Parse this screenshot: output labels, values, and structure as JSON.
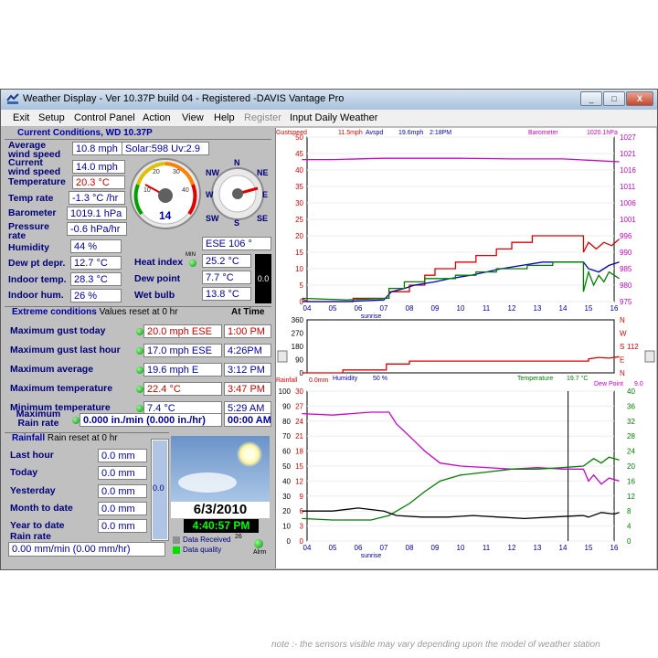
{
  "window": {
    "title": "Weather Display - Ver 10.37P build 04 - Registered  -DAVIS Vantage Pro",
    "buttons": {
      "minimize": "_",
      "maximize": "□",
      "close": "X"
    }
  },
  "menu": [
    "Exit",
    "Setup",
    "Control Panel",
    "Action",
    "View",
    "Help",
    "Register",
    "Input Daily Weather"
  ],
  "current": {
    "heading": "Current Conditions, WD 10.37P",
    "avg_wind_label": "Average wind speed",
    "avg_wind": "10.8 mph",
    "solar": "Solar:598 Uv:2.9",
    "cur_wind_label": "Current wind speed",
    "cur_wind": "14.0 mph",
    "temp_label": "Temperature",
    "temp": "20.3 °C",
    "temp_rate_label": "Temp rate",
    "temp_rate": "-1.3 °C /hr",
    "baro_label": "Barometer",
    "baro": "1019.1 hPa",
    "press_rate_label": "Pressure rate",
    "press_rate": "-0.6 hPa/hr",
    "humidity_label": "Humidity",
    "humidity": "44 %",
    "dew_label": "Dew pt depr.",
    "dew": "12.7 °C",
    "indoor_temp_label": "Indoor temp.",
    "indoor_temp": "28.3 °C",
    "indoor_hum_label": "Indoor hum.",
    "indoor_hum": "26 %",
    "heat_label": "Heat index",
    "heat": "25.2 °C",
    "min_label": "MIN",
    "dewpoint_label": "Dew point",
    "dewpoint": "7.7 °C",
    "wetbulb_label": "Wet bulb",
    "wetbulb": "13.8 °C",
    "wind_dir": "ESE  106 °",
    "gauge_value": "14",
    "gauge_ticks": [
      "10",
      "20",
      "30",
      "40"
    ],
    "compass": {
      "n": "N",
      "ne": "NE",
      "e": "E",
      "se": "SE",
      "s": "S",
      "sw": "SW",
      "w": "W",
      "nw": "NW"
    },
    "black_box": "0.0"
  },
  "extreme": {
    "heading": "Extreme conditions",
    "sub": "Values reset at 0 hr",
    "at_time": "At Time",
    "rows": [
      {
        "label": "Maximum gust today",
        "value": "20.0 mph ESE",
        "time": "1:00 PM",
        "red": true
      },
      {
        "label": "Maximum gust last hour",
        "value": "17.0 mph ESE",
        "time": "4:26PM",
        "red": false
      },
      {
        "label": "Maximum average",
        "value": "19.6 mph E",
        "time": "3:12 PM",
        "red": false
      },
      {
        "label": "Maximum temperature",
        "value": "22.4 °C",
        "time": "3:47 PM",
        "red": true
      },
      {
        "label": "Minimum temperature",
        "value": "7.4 °C",
        "time": "5:29 AM",
        "red": false
      }
    ],
    "rain_rate_label": "Maximum Rain rate",
    "rain_rate": "0.000 in./min (0.000 in./hr)",
    "rain_rate_time": "00:00 AM"
  },
  "rainfall": {
    "heading": "Rainfall",
    "sub": "Rain reset at 0 hr",
    "rows": [
      {
        "label": "Last hour",
        "value": "0.0 mm"
      },
      {
        "label": "Today",
        "value": "0.0 mm"
      },
      {
        "label": "Yesterday",
        "value": "0.0 mm"
      },
      {
        "label": "Month to date",
        "value": "0.0 mm"
      },
      {
        "label": "Year to date",
        "value": "0.0 mm"
      }
    ],
    "gauge": "0.0",
    "rate_label": "Rain rate",
    "rate": "0.00 mm/min (0.00 mm/hr)"
  },
  "status": {
    "date": "6/3/2010",
    "clock": "4:40:57 PM",
    "data_received": "Data Received",
    "data_received_count": "26",
    "data_quality": "Data quality",
    "alarm": "Alrm"
  },
  "colors": {
    "gust": "#e00000",
    "avg": "#0000c0",
    "baro": "#d000d0",
    "temp": "#008000",
    "humidity": "#d000d0"
  },
  "chart_data": [
    {
      "type": "line",
      "header": {
        "gust_label": "Gustspeed",
        "gust_val": "11.5mph",
        "avg_label": "Avspd",
        "avg_val": "19.6mph",
        "time": "2:18PM",
        "baro_label": "Barometer",
        "baro_val": "1020.1hPa"
      },
      "x_ticks": [
        "04",
        "05",
        "06",
        "07",
        "08",
        "09",
        "10",
        "11",
        "12",
        "13",
        "14",
        "15",
        "16"
      ],
      "xlabel": "sunrise",
      "y_left_ticks": [
        "50",
        "45",
        "40",
        "35",
        "30",
        "25",
        "20",
        "15",
        "10",
        "5",
        "0"
      ],
      "y_right_ticks": [
        "1027",
        "1021",
        "1016",
        "1011",
        "1006",
        "1001",
        "996",
        "990",
        "985",
        "980",
        "975"
      ],
      "ylim": [
        0,
        50
      ],
      "y2lim": [
        975,
        1027
      ],
      "series": [
        {
          "key": "baro",
          "axis": "right",
          "points": [
            [
              3.8,
              1019.9
            ],
            [
              5,
              1019.9
            ],
            [
              7,
              1020.3
            ],
            [
              10,
              1020.3
            ],
            [
              12,
              1020.1
            ],
            [
              14,
              1020.1
            ],
            [
              15,
              1019.7
            ],
            [
              16.2,
              1019.2
            ]
          ]
        },
        {
          "key": "gust",
          "axis": "left",
          "points": [
            [
              3.8,
              1
            ],
            [
              4,
              0
            ],
            [
              5.8,
              0
            ],
            [
              5.8,
              1
            ],
            [
              7.2,
              1
            ],
            [
              7.2,
              3
            ],
            [
              8,
              3
            ],
            [
              8,
              5
            ],
            [
              8.6,
              5
            ],
            [
              8.6,
              8
            ],
            [
              9,
              8
            ],
            [
              9,
              10
            ],
            [
              9.8,
              10
            ],
            [
              9.8,
              12
            ],
            [
              10.6,
              12
            ],
            [
              10.6,
              14
            ],
            [
              11.4,
              14
            ],
            [
              11.4,
              16
            ],
            [
              12,
              16
            ],
            [
              12,
              18
            ],
            [
              12.8,
              18
            ],
            [
              12.8,
              20
            ],
            [
              14.8,
              20
            ],
            [
              14.8,
              15
            ],
            [
              15,
              18
            ],
            [
              15.3,
              16
            ],
            [
              15.6,
              18
            ],
            [
              15.9,
              17
            ],
            [
              16.2,
              19
            ]
          ]
        },
        {
          "key": "avg",
          "axis": "left",
          "points": [
            [
              3.8,
              0
            ],
            [
              5.5,
              0
            ],
            [
              7,
              0.5
            ],
            [
              7.3,
              3
            ],
            [
              7.8,
              4
            ],
            [
              8.2,
              5
            ],
            [
              9,
              6
            ],
            [
              9.6,
              7
            ],
            [
              10.4,
              8
            ],
            [
              11,
              9
            ],
            [
              11.6,
              10
            ],
            [
              12.4,
              11
            ],
            [
              13.2,
              12
            ],
            [
              14.8,
              12
            ],
            [
              15,
              10
            ],
            [
              15.4,
              9
            ],
            [
              15.8,
              11
            ],
            [
              16.2,
              12
            ]
          ]
        },
        {
          "key": "temp",
          "axis": "left",
          "points": [
            [
              3.8,
              1
            ],
            [
              5.5,
              0.5
            ],
            [
              7.2,
              1
            ],
            [
              7.2,
              4
            ],
            [
              7.8,
              4
            ],
            [
              7.8,
              6
            ],
            [
              8.6,
              6
            ],
            [
              8.6,
              7
            ],
            [
              9.8,
              7
            ],
            [
              9.8,
              8
            ],
            [
              10.6,
              8
            ],
            [
              10.6,
              9
            ],
            [
              11.4,
              9
            ],
            [
              11.4,
              10
            ],
            [
              12.6,
              10
            ],
            [
              12.6,
              11
            ],
            [
              13.6,
              11
            ],
            [
              13.6,
              12
            ],
            [
              14.8,
              12
            ],
            [
              14.8,
              3
            ],
            [
              15,
              9
            ],
            [
              15.2,
              5
            ],
            [
              15.4,
              8
            ],
            [
              15.6,
              6
            ],
            [
              15.8,
              9
            ],
            [
              16.2,
              7
            ]
          ]
        }
      ]
    },
    {
      "type": "line",
      "y_left_ticks": [
        "360",
        "270",
        "180",
        "90",
        "0"
      ],
      "y_right_ticks": [
        "N",
        "W",
        "S",
        "E",
        "N"
      ],
      "right_value": "112",
      "ylim": [
        0,
        360
      ],
      "series": [
        {
          "key": "gust",
          "axis": "left",
          "points": [
            [
              3.8,
              0
            ],
            [
              5.4,
              0
            ],
            [
              5.4,
              20
            ],
            [
              7.1,
              20
            ],
            [
              7.1,
              60
            ],
            [
              8,
              60
            ],
            [
              8,
              80
            ],
            [
              15,
              80
            ],
            [
              15,
              95
            ],
            [
              15.4,
              105
            ],
            [
              15.8,
              100
            ],
            [
              16.2,
              110
            ]
          ]
        }
      ]
    },
    {
      "type": "line",
      "header": {
        "rain_label": "Rainfall",
        "rain_val": "0.0mm",
        "hum_label": "Humidity",
        "hum_val": "50 %",
        "temp_label": "Temperature",
        "temp_val": "19.7 °C",
        "dew_label": "Dew Point",
        "dew_val": "9.0"
      },
      "x_ticks": [
        "04",
        "05",
        "06",
        "07",
        "08",
        "09",
        "10",
        "11",
        "12",
        "13",
        "14",
        "15",
        "16"
      ],
      "xlabel": "sunrise",
      "y_outer_ticks": [
        "100",
        "90",
        "80",
        "70",
        "60",
        "50",
        "40",
        "30",
        "20",
        "10",
        "0"
      ],
      "y_inner_ticks": [
        "30",
        "27",
        "24",
        "21",
        "18",
        "15",
        "12",
        "9",
        "6",
        "3",
        "0"
      ],
      "y_right_ticks": [
        "40",
        "36",
        "32",
        "28",
        "24",
        "20",
        "16",
        "12",
        "8",
        "4",
        "0"
      ],
      "ylim": [
        0,
        100
      ],
      "y2lim": [
        0,
        40
      ],
      "series": [
        {
          "key": "humidity",
          "axis": "left",
          "points": [
            [
              3.8,
              85
            ],
            [
              5,
              84
            ],
            [
              6.5,
              86
            ],
            [
              7.2,
              86
            ],
            [
              7.5,
              78
            ],
            [
              8,
              70
            ],
            [
              8.6,
              60
            ],
            [
              9.2,
              52
            ],
            [
              10,
              50
            ],
            [
              11,
              49
            ],
            [
              12,
              48
            ],
            [
              13,
              49
            ],
            [
              14,
              48
            ],
            [
              14.8,
              48
            ],
            [
              15,
              40
            ],
            [
              15.2,
              44
            ],
            [
              15.5,
              38
            ],
            [
              15.8,
              42
            ],
            [
              16.2,
              40
            ]
          ]
        },
        {
          "key": "temp",
          "axis": "left",
          "points": [
            [
              3.8,
              15
            ],
            [
              5,
              14
            ],
            [
              6.5,
              14
            ],
            [
              7.2,
              17
            ],
            [
              8,
              25
            ],
            [
              8.6,
              33
            ],
            [
              9.2,
              40
            ],
            [
              10,
              44
            ],
            [
              11,
              46
            ],
            [
              12,
              48
            ],
            [
              13,
              48
            ],
            [
              14,
              49
            ],
            [
              14.8,
              50
            ],
            [
              15.2,
              55
            ],
            [
              15.5,
              52
            ],
            [
              15.8,
              56
            ],
            [
              16.2,
              54
            ]
          ]
        },
        {
          "key": "dewpoint",
          "axis": "left",
          "points": [
            [
              3.8,
              20
            ],
            [
              5,
              20
            ],
            [
              6,
              22
            ],
            [
              7,
              20
            ],
            [
              7.5,
              17
            ],
            [
              8.5,
              16
            ],
            [
              9.5,
              16
            ],
            [
              10.5,
              17
            ],
            [
              11.5,
              16
            ],
            [
              12.5,
              15
            ],
            [
              13.5,
              16
            ],
            [
              14.8,
              17
            ],
            [
              15,
              16
            ],
            [
              15.5,
              19
            ],
            [
              16,
              18
            ],
            [
              16.2,
              19
            ]
          ]
        }
      ]
    }
  ],
  "note": "note :- the sensors visible may vary depending upon the model of weather station"
}
